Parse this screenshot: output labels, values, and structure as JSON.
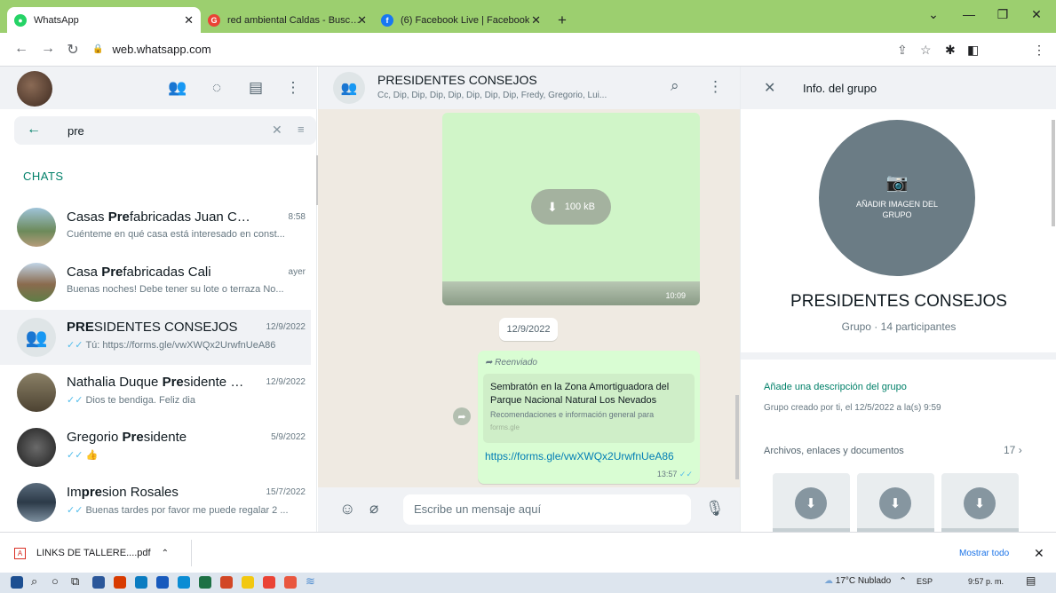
{
  "browser": {
    "tabs": [
      {
        "label": "WhatsApp",
        "icon": "whatsapp-icon",
        "color": "#25d366"
      },
      {
        "label": "red ambiental Caldas - Buscar co",
        "icon": "google-icon",
        "color": "#ea4335"
      },
      {
        "label": "(6) Facebook Live | Facebook",
        "icon": "facebook-icon",
        "color": "#1877f2"
      }
    ],
    "new_tab": "+",
    "url": "web.whatsapp.com"
  },
  "search": {
    "value": "pre"
  },
  "chats_title": "CHATS",
  "chats": [
    {
      "pre": "Casas ",
      "hl": "Pre",
      "post": "fabricadas Juan Camilo Q...",
      "time": "8:58",
      "preview": "Cuénteme en qué casa está interesado en const...",
      "tick": ""
    },
    {
      "pre": "Casa ",
      "hl": "Pre",
      "post": "fabricadas Cali",
      "time": "ayer",
      "preview": "Buenas noches! Debe tener su lote o terraza No...",
      "tick": ""
    },
    {
      "pre": "",
      "hl": "PRE",
      "post": "SIDENTES CONSEJOS",
      "time": "12/9/2022",
      "preview": "Tú: https://forms.gle/vwXWQx2UrwfnUeA86",
      "tick": "✓✓"
    },
    {
      "pre": "Nathalia Duque ",
      "hl": "Pre",
      "post": "sidente Ca...",
      "time": "12/9/2022",
      "preview": "Dios te bendiga.  Feliz dia",
      "tick": "✓✓"
    },
    {
      "pre": "Gregorio  ",
      "hl": "Pre",
      "post": "sidente",
      "time": "5/9/2022",
      "preview": "👍",
      "tick": "✓✓"
    },
    {
      "pre": "Im",
      "hl": "pre",
      "post": "sion Rosales",
      "time": "15/7/2022",
      "preview": "Buenas tardes por favor me puede regalar 2 ...",
      "tick": "✓✓"
    }
  ],
  "conversation": {
    "title": "PRESIDENTES CONSEJOS",
    "members": "Cc, Dip, Dip, Dip, Dip, Dip, Dip, Dip, Fredy, Gregorio, Lui...",
    "file_size": "100 kB",
    "file_time": "10:09",
    "date_chip": "12/9/2022",
    "forwarded": "Reenviado",
    "preview_title": "Sembratón en la Zona Amortiguadora del Parque Nacional Natural Los Nevados",
    "preview_desc": "Recomendaciones e información general para",
    "preview_domain": "forms.gle",
    "link": "https://forms.gle/vwXWQx2UrwfnUeA86",
    "msg_time": "13:57",
    "input_placeholder": "Escribe un mensaje aquí"
  },
  "group_info": {
    "header": "Info. del grupo",
    "add_image": "AÑADIR IMAGEN DEL GRUPO",
    "name": "PRESIDENTES CONSEJOS",
    "meta": "Grupo · 14 participantes",
    "add_desc": "Añade una descripción del grupo",
    "created": "Grupo creado por ti, el 12/5/2022 a la(s) 9:59",
    "files_label": "Archivos, enlaces y documentos",
    "files_count": "17"
  },
  "downloads": {
    "file": "LINKS DE TALLERE....pdf",
    "show_all": "Mostrar todo"
  },
  "taskbar": {
    "weather": "17°C  Nublado",
    "lang": "ESP",
    "time": "9:57 p. m."
  },
  "colors": {
    "accent": "#008069",
    "bubble": "#d9fdd3",
    "tabbar": "#9ccf6f"
  }
}
